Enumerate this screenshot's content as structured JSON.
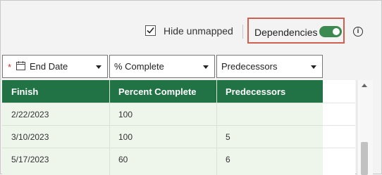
{
  "toolbar": {
    "hide_unmapped_label": "Hide unmapped",
    "hide_unmapped_checked": true,
    "dependencies_label": "Dependencies",
    "dependencies_on": true,
    "info_glyph": "i"
  },
  "mapping": {
    "fields": [
      {
        "label": "End Date",
        "required": true,
        "required_mark": "*",
        "icon": "calendar-icon"
      },
      {
        "label": "% Complete"
      },
      {
        "label": "Predecessors"
      }
    ]
  },
  "table": {
    "columns": [
      "Finish",
      "Percent Complete",
      "Predecessors"
    ],
    "rows": [
      [
        "2/22/2023",
        "100",
        ""
      ],
      [
        "3/10/2023",
        "100",
        "5"
      ],
      [
        "5/17/2023",
        "60",
        "6"
      ]
    ]
  },
  "colors": {
    "header_green": "#217346",
    "toggle_green": "#3c8a52",
    "highlight_red": "#d05f4f",
    "row_bg": "#eef6ec"
  }
}
